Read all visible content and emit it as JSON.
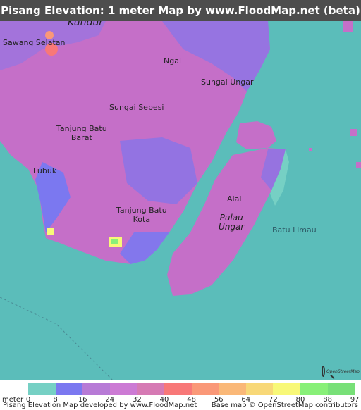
{
  "title": "Pisang Elevation: 1 meter Map by www.FloodMap.net (beta)",
  "places": {
    "kundur": "Kundur",
    "sawang_selatan": "Sawang Selatan",
    "ngal": "Ngal",
    "sungai_ungar": "Sungai Ungar",
    "sungai_sebesi": "Sungai Sebesi",
    "tanjung_batu_barat_1": "Tanjung Batu",
    "tanjung_batu_barat_2": "Barat",
    "lubuk": "Lubuk",
    "tanjung_batu_kota_1": "Tanjung Batu",
    "tanjung_batu_kota_2": "Kota",
    "alai": "Alai",
    "pulau_ungar_1": "Pulau",
    "pulau_ungar_2": "Ungar",
    "batu_limau": "Batu Limau"
  },
  "osm_badge": "OpenStreetMap",
  "legend": {
    "unit": "meter",
    "ticks": [
      "0",
      "8",
      "16",
      "24",
      "32",
      "40",
      "48",
      "56",
      "64",
      "72",
      "80",
      "88",
      "97"
    ],
    "colors": [
      "#76d0c4",
      "#7b78f0",
      "#b77ad6",
      "#cc7ad4",
      "#d67ab4",
      "#f87878",
      "#fa9878",
      "#fab878",
      "#f8d878",
      "#f8f878",
      "#88f078",
      "#78e078"
    ]
  },
  "footer": {
    "left": "Pisang Elevation Map developed by www.FloodMap.net",
    "right": "Base map © OpenStreetMap contributors"
  },
  "colors": {
    "sea": "#5bbdba",
    "land_low": "#c56fc8",
    "land_mid": "#7b78f0",
    "title_bar": "#4d4d4d"
  }
}
